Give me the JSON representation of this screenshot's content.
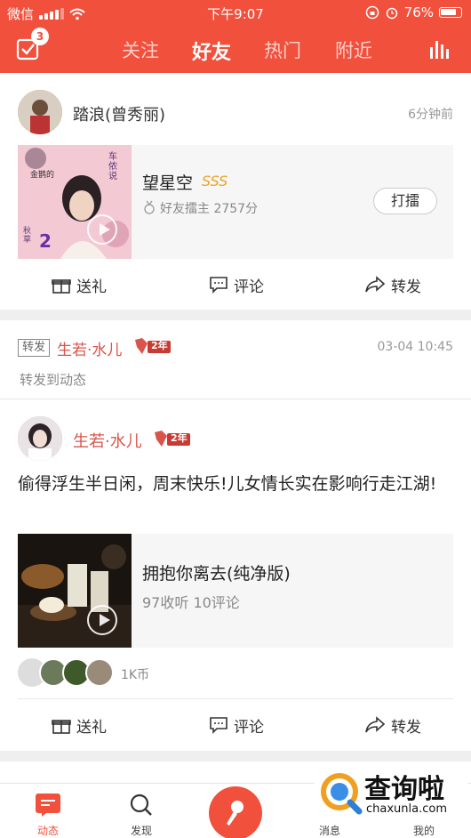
{
  "status_bar": {
    "carrier": "微信",
    "time": "下午9:07",
    "battery": "76%"
  },
  "header": {
    "badge_count": "3",
    "tabs": [
      {
        "label": "关注",
        "active": false
      },
      {
        "label": "好友",
        "active": true
      },
      {
        "label": "热门",
        "active": false
      },
      {
        "label": "附近",
        "active": false
      }
    ],
    "accent_color": "#f0503c"
  },
  "feed": {
    "post1": {
      "user": "踏浪(曾秀丽)",
      "time": "6分钟前",
      "song_title": "望星空",
      "level": "SSS",
      "host_label": "好友擂主",
      "score": "2757分",
      "cover_text_1": "金鹊的",
      "cover_text_2": "车侬说",
      "cover_text_3": "秋草",
      "cover_text_4": "2",
      "action_button": "打擂"
    },
    "actions": {
      "gift": "送礼",
      "comment": "评论",
      "share": "转发"
    },
    "repost": {
      "tag": "转发",
      "user": "生若·水儿",
      "vip_label": "2年",
      "time": "03-04 10:45",
      "note": "转发到动态"
    },
    "post2": {
      "user": "生若·水儿",
      "vip_label": "2年",
      "text": "偷得浮生半日闲，周末快乐!儿女情长实在影响行走江湖!",
      "song_title": "拥抱你离去(纯净版)",
      "stats": "97收听 10评论",
      "coins": "1K币"
    }
  },
  "bottom_tabs": [
    {
      "label": "动态",
      "active": true
    },
    {
      "label": "发现",
      "active": false
    },
    {
      "label": "消息",
      "active": false
    },
    {
      "label": "我的",
      "active": false
    }
  ],
  "watermark": {
    "brand": "查询啦",
    "url": "chaxunla.com"
  }
}
